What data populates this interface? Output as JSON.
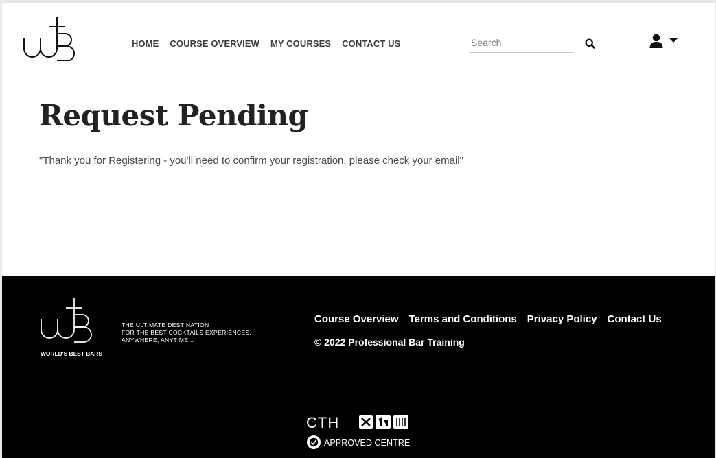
{
  "header": {
    "logo_icon": "wbb-monogram-logo",
    "nav": [
      {
        "label": "HOME"
      },
      {
        "label": "COURSE OVERVIEW"
      },
      {
        "label": "MY COURSES"
      },
      {
        "label": "CONTACT US"
      }
    ],
    "search": {
      "placeholder": "Search",
      "value": "",
      "icon": "search-icon"
    },
    "user_menu": {
      "icon": "user-icon",
      "caret": "caret-down-icon"
    }
  },
  "main": {
    "title": "Request Pending",
    "message": "\"Thank you for Registering - you'll need to confirm your registration, please check your email\""
  },
  "footer": {
    "logo_icon": "wbb-monogram-logo",
    "logo_text": "WORLD'S BEST BARS",
    "tagline": [
      "THE ULTIMATE DESTINATION",
      "FOR THE BEST COCKTAILS EXPERIENCES,",
      "ANYWHERE, ANYTIME..."
    ],
    "links": [
      {
        "label": "Course Overview"
      },
      {
        "label": "Terms and Conditions"
      },
      {
        "label": "Privacy Policy"
      },
      {
        "label": "Contact Us"
      }
    ],
    "copyright": "© 2022 Professional Bar Training",
    "badge": {
      "brand": "CTH",
      "caption": "APPROVED CENTRE"
    }
  },
  "colors": {
    "page_bg": "#ffffff",
    "footer_bg": "#000000",
    "nav_text": "#3d3d3d",
    "title_text": "#222222"
  }
}
